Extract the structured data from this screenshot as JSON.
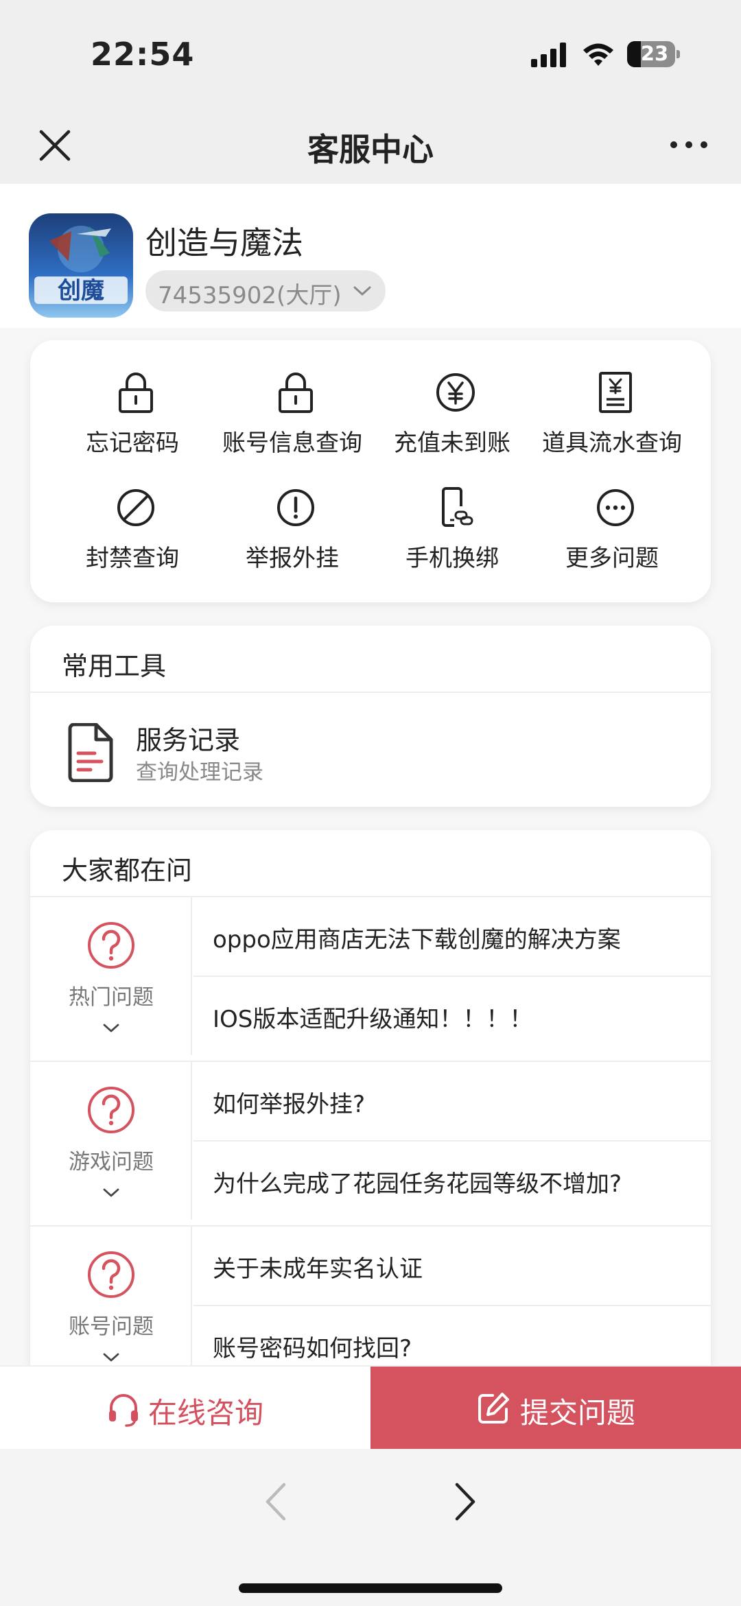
{
  "status_bar": {
    "time": "22:54",
    "battery": "23"
  },
  "nav": {
    "title": "客服中心"
  },
  "app": {
    "name": "创造与魔法",
    "account": "74535902(大厅)",
    "icon_text": "创魔"
  },
  "quick_actions": [
    {
      "label": "忘记密码",
      "icon": "lock-icon"
    },
    {
      "label": "账号信息查询",
      "icon": "lock-icon"
    },
    {
      "label": "充值未到账",
      "icon": "yen-circle-icon"
    },
    {
      "label": "道具流水查询",
      "icon": "receipt-icon"
    },
    {
      "label": "封禁查询",
      "icon": "ban-icon"
    },
    {
      "label": "举报外挂",
      "icon": "alert-icon"
    },
    {
      "label": "手机换绑",
      "icon": "phone-link-icon"
    },
    {
      "label": "更多问题",
      "icon": "more-circle-icon"
    }
  ],
  "tools": {
    "title": "常用工具",
    "item": {
      "title": "服务记录",
      "subtitle": "查询处理记录",
      "icon": "document-icon"
    }
  },
  "faq": {
    "title": "大家都在问",
    "groups": [
      {
        "category": "热门问题",
        "items": [
          "oppo应用商店无法下载创魔的解决方案",
          "IOS版本适配升级通知！！！！"
        ]
      },
      {
        "category": "游戏问题",
        "items": [
          "如何举报外挂?",
          "为什么完成了花园任务花园等级不增加?"
        ]
      },
      {
        "category": "账号问题",
        "items": [
          "关于未成年实名认证",
          "账号密码如何找回?"
        ]
      }
    ]
  },
  "bottom": {
    "consult_label": "在线咨询",
    "submit_label": "提交问题"
  },
  "colors": {
    "accent": "#d4535f",
    "background": "#f5f5f5"
  }
}
